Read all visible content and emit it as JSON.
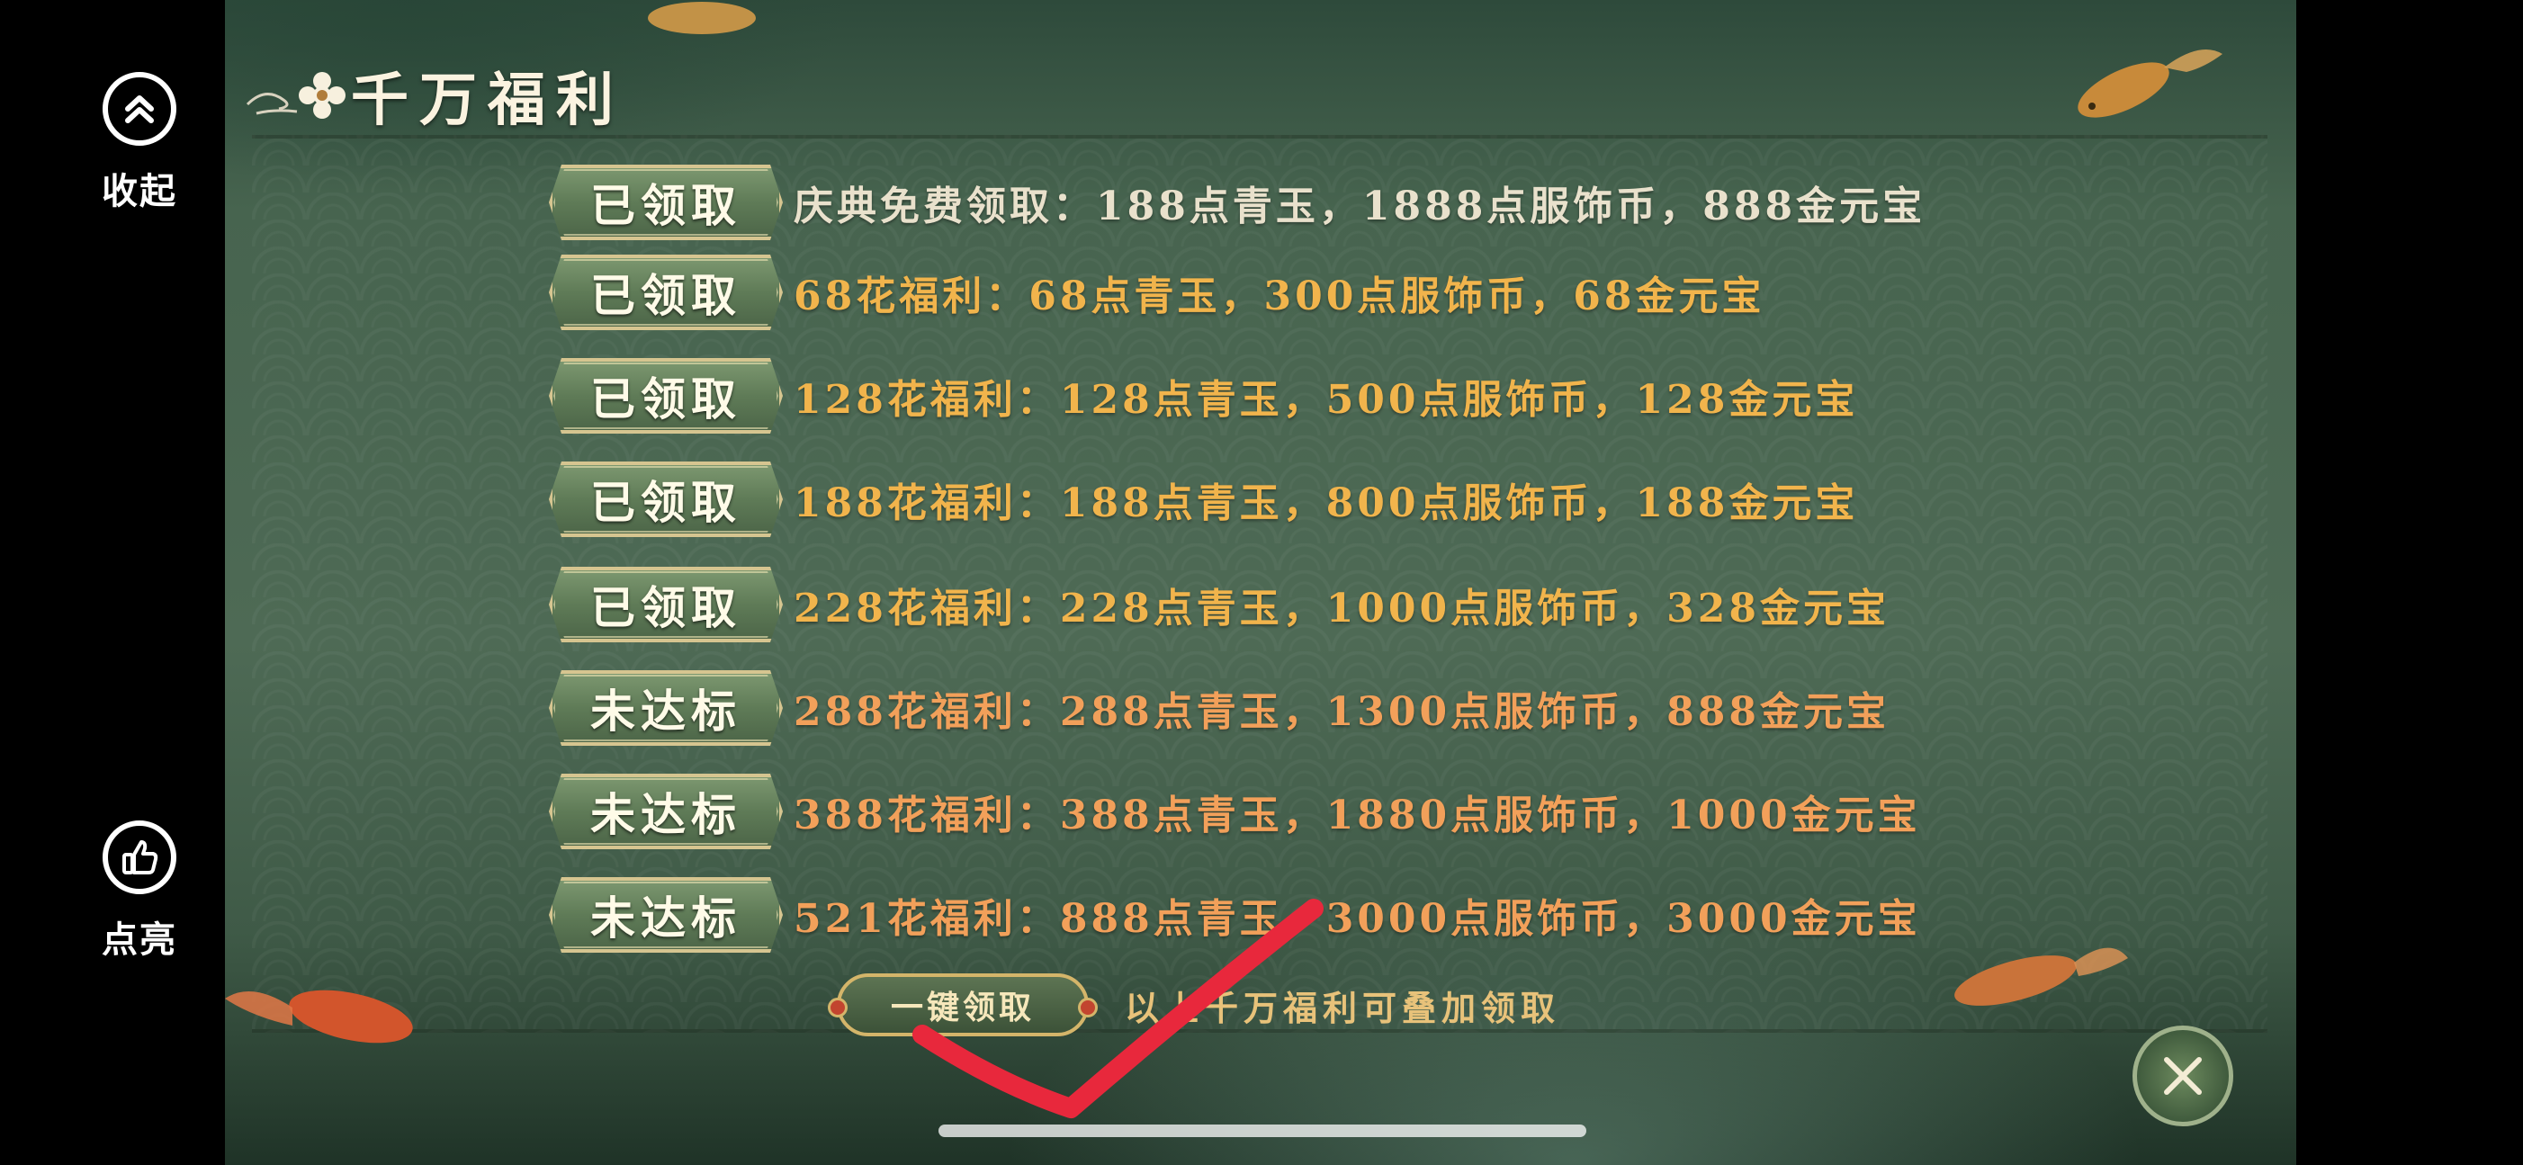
{
  "sidebar": {
    "collapse_label": "收起",
    "like_label": "点亮"
  },
  "panel": {
    "title": "千万福利",
    "rows": [
      {
        "status": "已领取",
        "text": "庆典免费领取：188点青玉，1888点服饰币，888金元宝",
        "color": "#e9e1cc"
      },
      {
        "status": "已领取",
        "text": "68花福利：68点青玉，300点服饰币，68金元宝",
        "color": "#f1b44c"
      },
      {
        "status": "已领取",
        "text": "128花福利：128点青玉，500点服饰币，128金元宝",
        "color": "#f1b44c"
      },
      {
        "status": "已领取",
        "text": "188花福利：188点青玉，800点服饰币，188金元宝",
        "color": "#f1b44c"
      },
      {
        "status": "已领取",
        "text": "228花福利：228点青玉，1000点服饰币，328金元宝",
        "color": "#f1b44c"
      },
      {
        "status": "未达标",
        "text": "288花福利：288点青玉，1300点服饰币，888金元宝",
        "color": "#f2a05a"
      },
      {
        "status": "未达标",
        "text": "388花福利：388点青玉，1880点服饰币，1000金元宝",
        "color": "#f2a05a"
      },
      {
        "status": "未达标",
        "text": "521花福利：888点青玉，3000点服饰币，3000金元宝",
        "color": "#f2a05a"
      }
    ],
    "claim_all_label": "一键领取",
    "note": "以上千万福利可叠加领取"
  },
  "icons": {
    "collapse": "double-chevron-up-icon",
    "like": "thumbs-up-icon",
    "close": "close-icon",
    "title_flower": "flower-icon"
  },
  "colors": {
    "panel_green": "#4e6a55",
    "gold": "#f1b44c",
    "orange": "#f2a05a",
    "annotation_red": "#e8283c"
  }
}
